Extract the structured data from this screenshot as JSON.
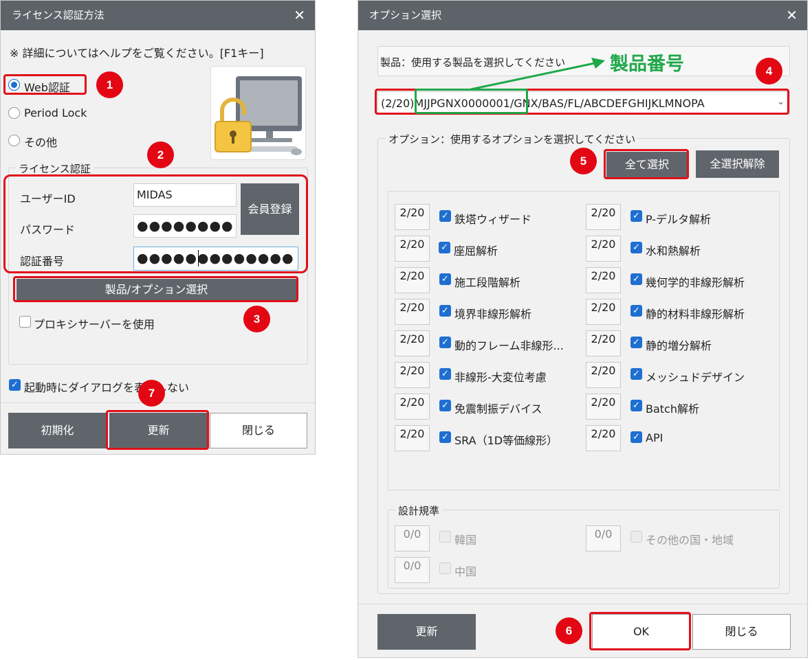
{
  "left_dialog": {
    "title": "ライセンス認証方法",
    "hint": "※ 詳細についてはヘルプをご覧ください。[F1キー]",
    "auth_options": [
      {
        "label": "Web認証",
        "selected": true
      },
      {
        "label": "Period Lock",
        "selected": false
      },
      {
        "label": "その他",
        "selected": false
      }
    ],
    "license_group_label": "ライセンス認証",
    "user_id_label": "ユーザーID",
    "user_id_value": "MIDAS",
    "password_label": "パスワード",
    "password_value": "●●●●●●●●",
    "auth_number_label": "認証番号",
    "auth_number_value": "●●●●●●●●●●●●●",
    "register_button": "会員登録",
    "product_option_button": "製品/オプション選択",
    "proxy_label": "プロキシサーバーを使用",
    "proxy_checked": false,
    "startup_label": "起動時にダイアログを表示しない",
    "startup_checked": true,
    "buttons": {
      "reset": "初期化",
      "update": "更新",
      "close": "閉じる"
    }
  },
  "right_dialog": {
    "title": "オプション選択",
    "product_prompt": "製品：使用する製品を選択してください",
    "product_value": "(2/20)MJJPGNX0000001/GNX/BAS/FL/ABCDEFGHIJKLMNOPA",
    "option_group_label": "オプション：使用するオプションを選択してください",
    "select_all": "全て選択",
    "deselect_all": "全選択解除",
    "options_left": [
      {
        "count": "2/20",
        "label": "鉄塔ウィザード",
        "checked": true
      },
      {
        "count": "2/20",
        "label": "座屈解析",
        "checked": true
      },
      {
        "count": "2/20",
        "label": "施工段階解析",
        "checked": true
      },
      {
        "count": "2/20",
        "label": "境界非線形解析",
        "checked": true
      },
      {
        "count": "2/20",
        "label": "動的フレーム非線形...",
        "checked": true
      },
      {
        "count": "2/20",
        "label": "非線形-大変位考慮",
        "checked": true
      },
      {
        "count": "2/20",
        "label": "免震制振デバイス",
        "checked": true
      },
      {
        "count": "2/20",
        "label": "SRA（1D等価線形）",
        "checked": true
      }
    ],
    "options_right": [
      {
        "count": "2/20",
        "label": "P-デルタ解析",
        "checked": true
      },
      {
        "count": "2/20",
        "label": "水和熱解析",
        "checked": true
      },
      {
        "count": "2/20",
        "label": "幾何学的非線形解析",
        "checked": true
      },
      {
        "count": "2/20",
        "label": "静的材料非線形解析",
        "checked": true
      },
      {
        "count": "2/20",
        "label": "静的増分解析",
        "checked": true
      },
      {
        "count": "2/20",
        "label": "メッシュドデザイン",
        "checked": true
      },
      {
        "count": "2/20",
        "label": "Batch解析",
        "checked": true
      },
      {
        "count": "2/20",
        "label": "API",
        "checked": true
      }
    ],
    "design_group_label": "設計規準",
    "design_codes": [
      {
        "count": "0/0",
        "label": "韓国"
      },
      {
        "count": "0/0",
        "label": "中国"
      },
      {
        "count": "0/0",
        "label": "その他の国・地域"
      }
    ],
    "buttons": {
      "update": "更新",
      "ok": "OK",
      "close": "閉じる"
    }
  },
  "annotations": {
    "product_number_label": "製品番号",
    "badges": [
      "1",
      "2",
      "3",
      "4",
      "5",
      "6",
      "7"
    ],
    "colors": {
      "highlight": "#e0101a",
      "callout": "#20a84a",
      "badge": "#e30613",
      "titlebar": "#5d6369"
    }
  }
}
